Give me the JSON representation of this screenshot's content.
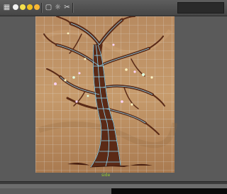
{
  "toolbar": {
    "items": [
      {
        "name": "select-mode-icon",
        "glyph": "▦"
      },
      {
        "name": "scene-view-icon",
        "glyph": "▢"
      },
      {
        "name": "render-icon",
        "glyph": "☼"
      },
      {
        "name": "settings-icon",
        "glyph": "⚙"
      },
      {
        "name": "tools-icon",
        "glyph": "✂"
      }
    ],
    "light_colors": [
      "#f2f2f2",
      "#f4e04d",
      "#f0c020",
      "#f7b733"
    ]
  },
  "viewport": {
    "camera_label": "side",
    "backdrop_color": "#b98a5e",
    "grid_color": "#d9d9d9",
    "wire_color": "#8fe0ff",
    "bark_color": "#5b2a16"
  }
}
